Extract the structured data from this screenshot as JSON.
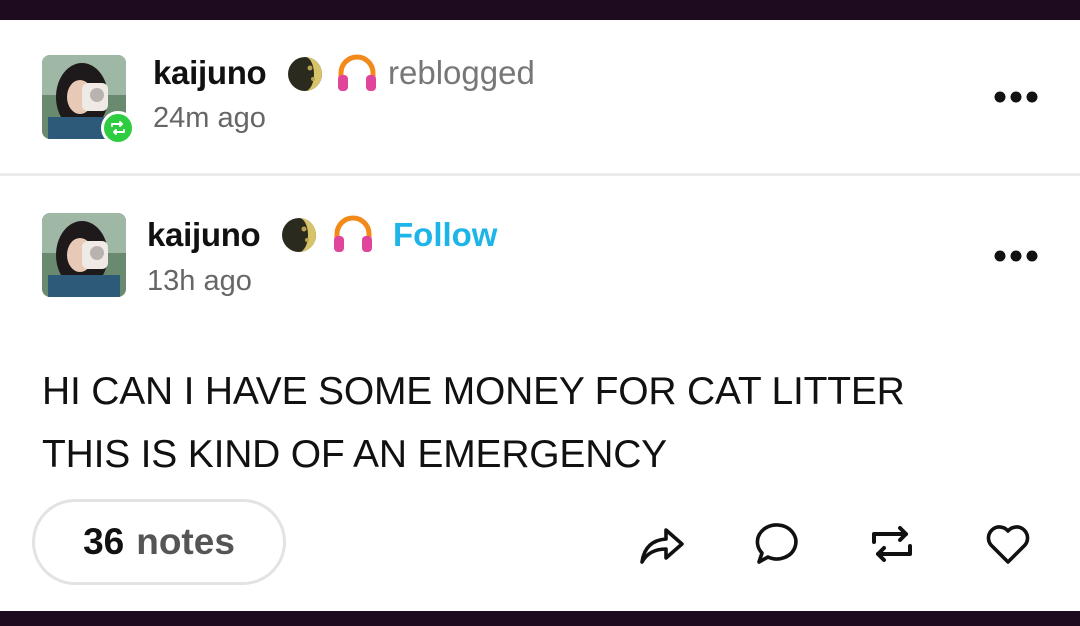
{
  "reblog_header": {
    "username": "kaijuno",
    "action_text": "reblogged",
    "timestamp": "24m ago",
    "moon_icon": "moon-emoji-icon",
    "headphones_icon": "headphones-emoji-icon",
    "badge_color": "#2ecc40"
  },
  "post": {
    "username": "kaijuno",
    "follow_label": "Follow",
    "timestamp": "13h ago",
    "body_lines": [
      "HI CAN I HAVE SOME MONEY FOR CAT LITTER",
      "THIS IS KIND OF AN EMERGENCY"
    ],
    "follow_color": "#1db4e8"
  },
  "footer": {
    "notes_count": "36",
    "notes_label": "notes",
    "actions": [
      "share-icon",
      "reply-icon",
      "reblog-icon",
      "like-icon"
    ]
  },
  "colors": {
    "bars": "#1f0b1f",
    "text": "#111111",
    "muted": "#777777"
  }
}
